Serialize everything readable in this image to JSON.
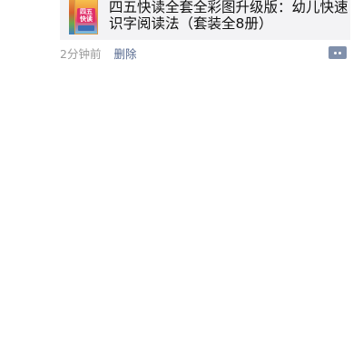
{
  "post": {
    "share_card": {
      "thumbnail_icon": "book-cover-thumbnail",
      "thumbnail_text": "四五快读",
      "title": "四五快读全套全彩图升级版：幼儿快速识字阅读法（套装全8册）"
    },
    "time": "2分钟前",
    "delete_label": "删除",
    "comment_icon": "comment-more-icon"
  },
  "colors": {
    "card_bg": "#f3f3f5",
    "link_blue": "#56698f",
    "time_gray": "#9a9a9a",
    "comment_button": "#8090ab"
  }
}
